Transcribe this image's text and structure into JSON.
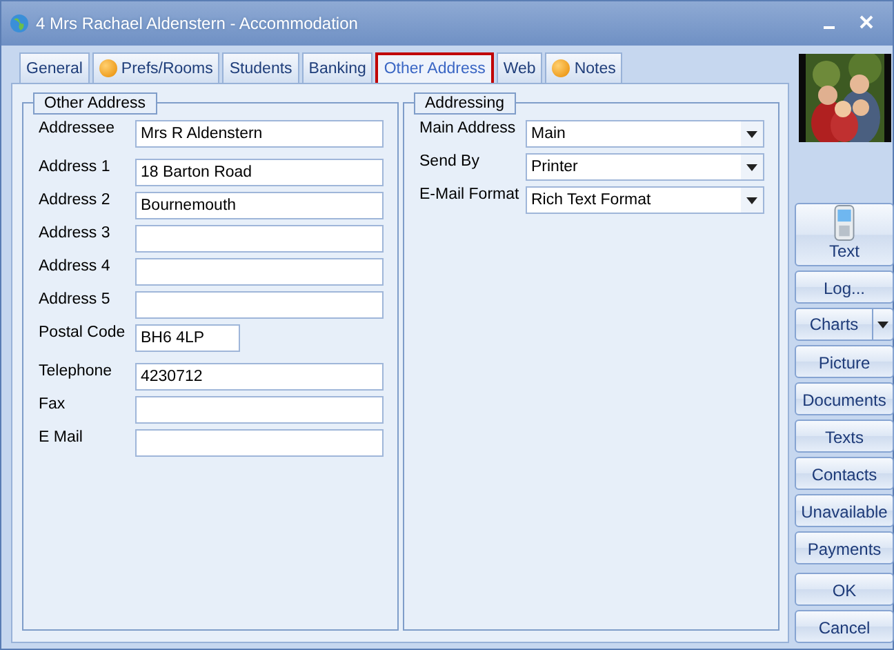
{
  "window": {
    "title": "4 Mrs Rachael Aldenstern - Accommodation"
  },
  "tabs": [
    {
      "label": "General",
      "selected": false,
      "info": false
    },
    {
      "label": "Prefs/Rooms",
      "selected": false,
      "info": true
    },
    {
      "label": "Students",
      "selected": false,
      "info": false
    },
    {
      "label": "Banking",
      "selected": false,
      "info": false
    },
    {
      "label": "Other Address",
      "selected": true,
      "info": false
    },
    {
      "label": "Web",
      "selected": false,
      "info": false
    },
    {
      "label": "Notes",
      "selected": false,
      "info": true
    }
  ],
  "other_address": {
    "title": "Other Address",
    "fields": [
      {
        "label": "Addressee",
        "value": "Mrs R Aldenstern",
        "kind": "wide"
      },
      {
        "label": "Address 1",
        "value": "18 Barton Road",
        "kind": "wide"
      },
      {
        "label": "Address 2",
        "value": "Bournemouth",
        "kind": "wide"
      },
      {
        "label": "Address 3",
        "kind": "wide"
      },
      {
        "label": "Address 4",
        "kind": "wide"
      },
      {
        "label": "Address 5",
        "kind": "wide"
      },
      {
        "label": "Postal Code",
        "value": "BH6 4LP",
        "kind": "short"
      },
      {
        "label": "Telephone",
        "value": "4230712",
        "kind": "wide"
      },
      {
        "label": "Fax",
        "kind": "wide"
      },
      {
        "label": "E Mail",
        "kind": "wide"
      }
    ]
  },
  "addressing": {
    "title": "Addressing",
    "fields": [
      {
        "label": "Main Address",
        "value": "Main"
      },
      {
        "label": "Send By",
        "value": "Printer"
      },
      {
        "label": "E-Mail Format",
        "value": "Rich Text Format"
      }
    ]
  },
  "buttons": [
    {
      "label": "Text",
      "kind": "phone"
    },
    {
      "label": "Log...",
      "kind": "plain"
    },
    {
      "label": "Charts",
      "kind": "split"
    },
    {
      "label": "Picture",
      "kind": "plain"
    },
    {
      "label": "Documents",
      "kind": "plain"
    },
    {
      "label": "Texts",
      "kind": "plain"
    },
    {
      "label": "Contacts",
      "kind": "plain"
    },
    {
      "label": "Unavailable",
      "kind": "plain"
    },
    {
      "label": "Payments",
      "kind": "plain"
    },
    {
      "label": "OK",
      "kind": "spaced"
    },
    {
      "label": "Cancel",
      "kind": "plain"
    }
  ]
}
